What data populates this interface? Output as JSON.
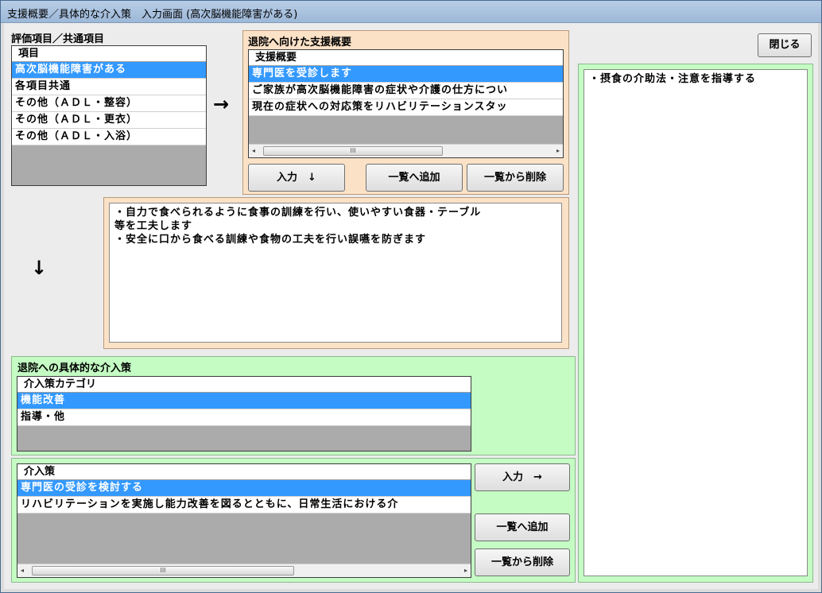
{
  "window": {
    "title": "支援概要／具体的な介入策　入力画面 (高次脳機能障害がある)"
  },
  "close_button": "閉じる",
  "eval": {
    "label": "評価項目／共通項目",
    "header": "項目",
    "items": [
      "高次脳機能障害がある",
      "各項目共通",
      "その他（ＡＤＬ・整容）",
      "その他（ＡＤＬ・更衣）",
      "その他（ＡＤＬ・入浴）"
    ]
  },
  "arrow_right": "→",
  "arrow_down": "↓",
  "support": {
    "label": "退院へ向けた支援概要",
    "header": "支援概要",
    "items": [
      "専門医を受診します",
      "ご家族が高次脳機能障害の症状や介護の仕方につい",
      "現在の症状への対応策をリハビリテーションスタッ"
    ],
    "input_button": "入力　↓",
    "add_button": "一覧へ追加",
    "delete_button": "一覧から削除",
    "text_lines": [
      "・自力で食べられるように食事の訓練を行い、使いやすい食器・テーブル",
      "等を工夫します",
      "・安全に口から食べる訓練や食物の工夫を行い誤嚥を防ぎます"
    ]
  },
  "category": {
    "label": "退院への具体的な介入策",
    "header": "介入策カテゴリ",
    "items": [
      "機能改善",
      "指導・他"
    ]
  },
  "intervention": {
    "header": "介入策",
    "items": [
      "専門医の受診を検討する",
      "リハビリテーションを実施し能力改善を図るとともに、日常生活における介"
    ],
    "input_button": "入力　→",
    "add_button": "一覧へ追加",
    "delete_button": "一覧から削除"
  },
  "result": {
    "text": "・摂食の介助法・注意を指導する"
  },
  "scroll_grip": "III",
  "scroll_left": "◂",
  "scroll_right": "▸"
}
